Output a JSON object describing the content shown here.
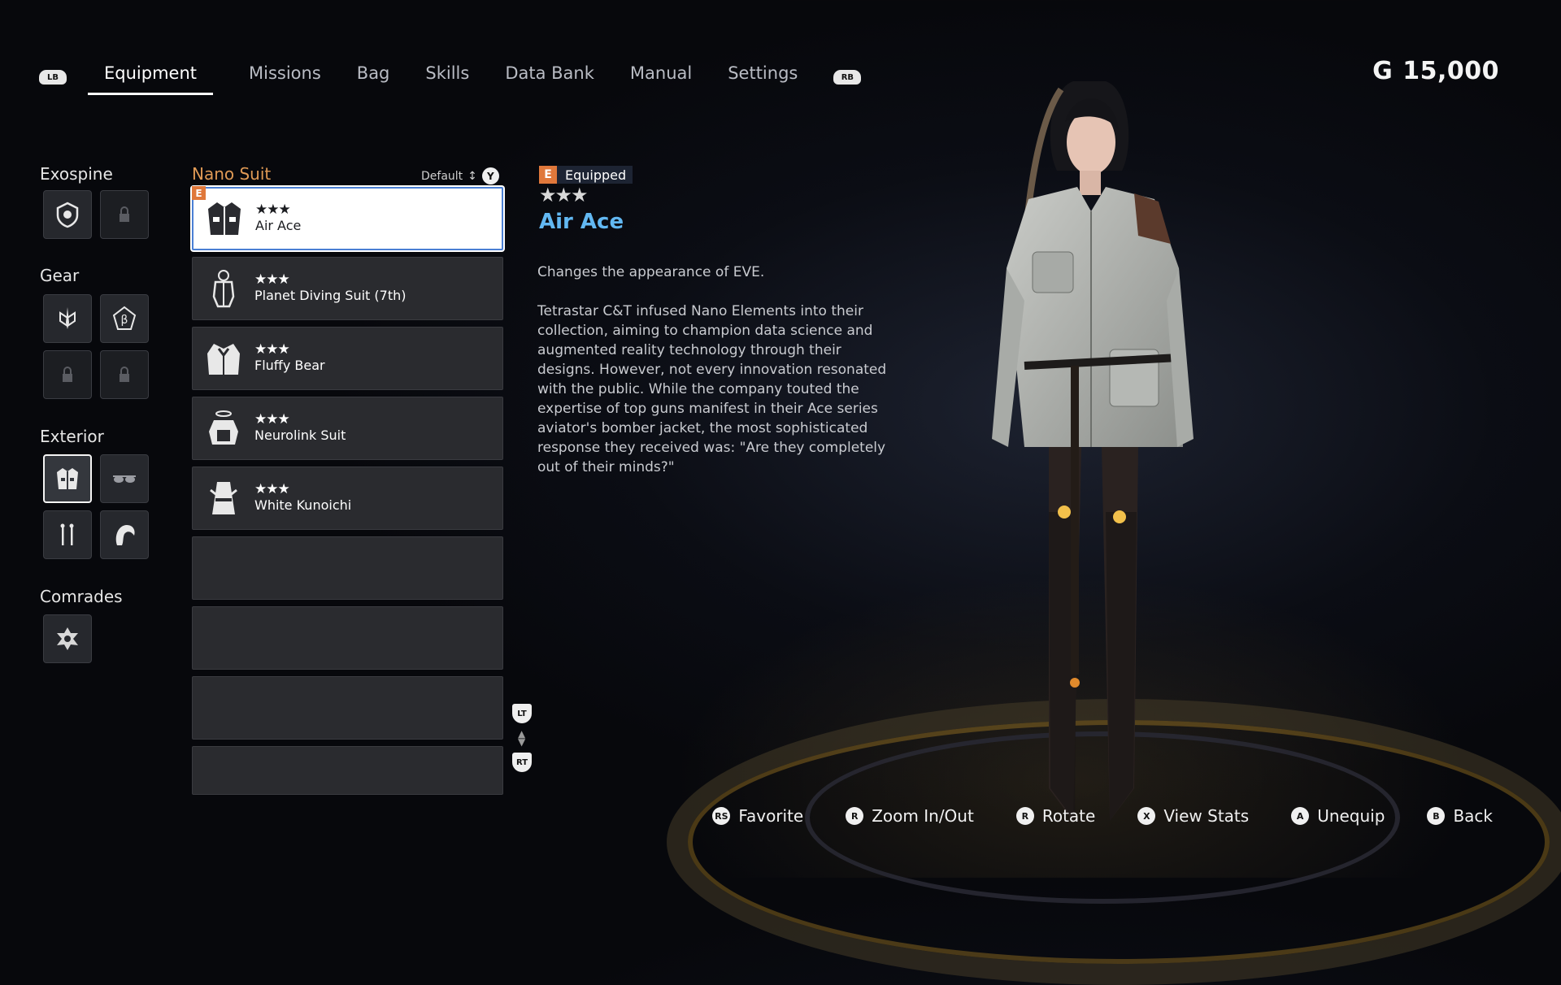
{
  "nav": {
    "lb": "LB",
    "rb": "RB",
    "tabs": [
      {
        "label": "Equipment",
        "active": true
      },
      {
        "label": "Missions",
        "active": false
      },
      {
        "label": "Bag",
        "active": false
      },
      {
        "label": "Skills",
        "active": false
      },
      {
        "label": "Data Bank",
        "active": false
      },
      {
        "label": "Manual",
        "active": false
      },
      {
        "label": "Settings",
        "active": false
      }
    ]
  },
  "currency": {
    "symbol": "G",
    "amount": "15,000"
  },
  "categories": {
    "exospine": "Exospine",
    "gear": "Gear",
    "exterior": "Exterior",
    "comrades": "Comrades"
  },
  "list": {
    "title": "Nano Suit",
    "sort_label": "Default",
    "sort_button": "Y",
    "equipped_badge": "E",
    "items": [
      {
        "stars": "★★★",
        "name": "Air Ace"
      },
      {
        "stars": "★★★",
        "name": "Planet Diving Suit (7th)"
      },
      {
        "stars": "★★★",
        "name": "Fluffy Bear"
      },
      {
        "stars": "★★★",
        "name": "Neurolink Suit"
      },
      {
        "stars": "★★★",
        "name": "White Kunoichi"
      }
    ],
    "lt": "LT",
    "rt": "RT"
  },
  "detail": {
    "equipped_letter": "E",
    "equipped_label": "Equipped",
    "stars": "★★★",
    "name": "Air Ace",
    "summary": "Changes the appearance of EVE.",
    "lore": "Tetrastar C&T infused Nano Elements into their collection, aiming to champion data science and augmented reality technology through their designs. However, not every innovation resonated with the public. While the company touted the expertise of top guns manifest in their Ace series aviator's bomber jacket, the most sophisticated response they received was: \"Are they completely out of their minds?\""
  },
  "prompts": [
    {
      "button": "RS",
      "label": "Favorite"
    },
    {
      "button": "R",
      "label": "Zoom In/Out"
    },
    {
      "button": "R",
      "label": "Rotate"
    },
    {
      "button": "X",
      "label": "View Stats"
    },
    {
      "button": "A",
      "label": "Unequip"
    },
    {
      "button": "B",
      "label": "Back"
    }
  ],
  "icons": {
    "exospine": "shield-emblem-icon",
    "locked": "lock-icon",
    "gear1": "sword-emblem-icon",
    "gear2": "beta-emblem-icon",
    "outfit": "jacket-icon",
    "glasses": "sunglasses-icon",
    "earrings": "earrings-icon",
    "hair": "hair-icon",
    "comrade": "drone-emblem-icon"
  }
}
